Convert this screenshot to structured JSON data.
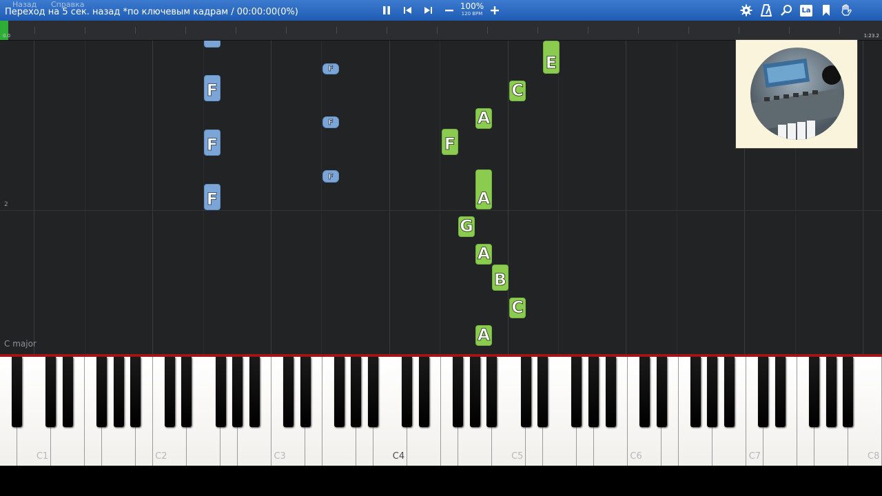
{
  "toolbar": {
    "status": "Переход на 5 сек. назад *по ключевым кадрам / 00:00:00(0%)",
    "ghost_left": "Назад",
    "ghost_right": "Справка",
    "speed_percent": "100%",
    "speed_bpm": "120 BPM",
    "lang_label": "La",
    "icons": [
      "pause-icon",
      "skip-back-icon",
      "skip-forward-icon",
      "minus-icon",
      "plus-icon",
      "gear-icon",
      "metronome-icon",
      "search-icon",
      "lang-icon",
      "bookmark-icon",
      "hand-icon"
    ],
    "color": "#2b6cc4"
  },
  "timeline": {
    "start": "0.0",
    "end": "1:23.2",
    "progress_color": "#2fae37"
  },
  "roll": {
    "measure_number": "2",
    "key_signature": "C major",
    "notes": [
      {
        "letter": "F",
        "hand": "left"
      },
      {
        "letter": "F",
        "hand": "left"
      },
      {
        "letter": "F",
        "hand": "left"
      },
      {
        "letter": "F",
        "hand": "left"
      },
      {
        "letter": "F",
        "hand": "left"
      },
      {
        "letter": "F",
        "hand": "left"
      },
      {
        "letter": "F",
        "hand": "left"
      },
      {
        "letter": "E",
        "hand": "right"
      },
      {
        "letter": "C",
        "hand": "right"
      },
      {
        "letter": "A",
        "hand": "right"
      },
      {
        "letter": "F",
        "hand": "right"
      },
      {
        "letter": "A",
        "hand": "right"
      },
      {
        "letter": "G",
        "hand": "right"
      },
      {
        "letter": "A",
        "hand": "right"
      },
      {
        "letter": "B",
        "hand": "right"
      },
      {
        "letter": "C",
        "hand": "right"
      },
      {
        "letter": "A",
        "hand": "right"
      }
    ],
    "right_hand_color": "#8bcb4f",
    "left_hand_color": "#7aa5d6"
  },
  "keyboard": {
    "octave_labels": [
      "C1",
      "C2",
      "C3",
      "C4",
      "C5",
      "C6",
      "C7",
      "C8"
    ],
    "top_border_color": "#a21616"
  }
}
